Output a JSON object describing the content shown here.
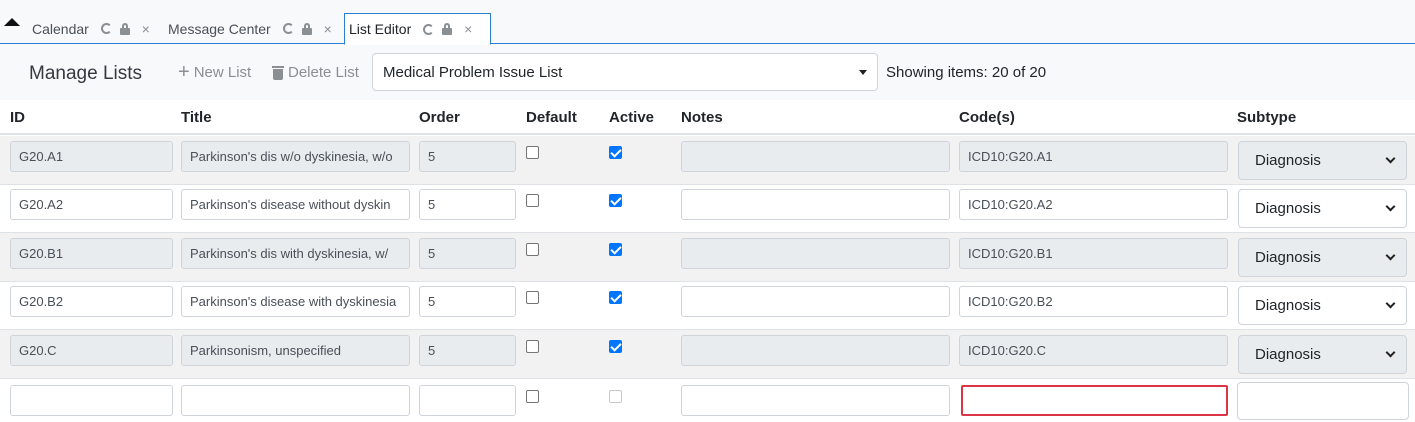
{
  "tabs": [
    {
      "label": "Calendar",
      "active": false
    },
    {
      "label": "Message Center",
      "active": false
    },
    {
      "label": "List Editor",
      "active": true
    }
  ],
  "toolbar": {
    "title": "Manage Lists",
    "new_list": "New List",
    "delete_list": "Delete List",
    "selected_list": "Medical Problem Issue List",
    "showing": "Showing items: 20 of 20"
  },
  "columns": {
    "id": "ID",
    "title": "Title",
    "order": "Order",
    "default": "Default",
    "active": "Active",
    "notes": "Notes",
    "codes": "Code(s)",
    "subtype": "Subtype"
  },
  "rows": [
    {
      "id": "G20.A1",
      "title": "Parkinson's dis w/o dyskinesia, w/o",
      "order": "5",
      "default": false,
      "active": true,
      "notes": "",
      "codes": "ICD10:G20.A1",
      "subtype": "Diagnosis"
    },
    {
      "id": "G20.A2",
      "title": "Parkinson's disease without dyskin",
      "order": "5",
      "default": false,
      "active": true,
      "notes": "",
      "codes": "ICD10:G20.A2",
      "subtype": "Diagnosis"
    },
    {
      "id": "G20.B1",
      "title": "Parkinson's dis with dyskinesia, w/",
      "order": "5",
      "default": false,
      "active": true,
      "notes": "",
      "codes": "ICD10:G20.B1",
      "subtype": "Diagnosis"
    },
    {
      "id": "G20.B2",
      "title": "Parkinson's disease with dyskinesia",
      "order": "5",
      "default": false,
      "active": true,
      "notes": "",
      "codes": "ICD10:G20.B2",
      "subtype": "Diagnosis"
    },
    {
      "id": "G20.C",
      "title": "Parkinsonism, unspecified",
      "order": "5",
      "default": false,
      "active": true,
      "notes": "",
      "codes": "ICD10:G20.C",
      "subtype": "Diagnosis"
    },
    {
      "id": "",
      "title": "",
      "order": "",
      "default": false,
      "active": false,
      "notes": "",
      "codes": "",
      "subtype": ""
    }
  ]
}
